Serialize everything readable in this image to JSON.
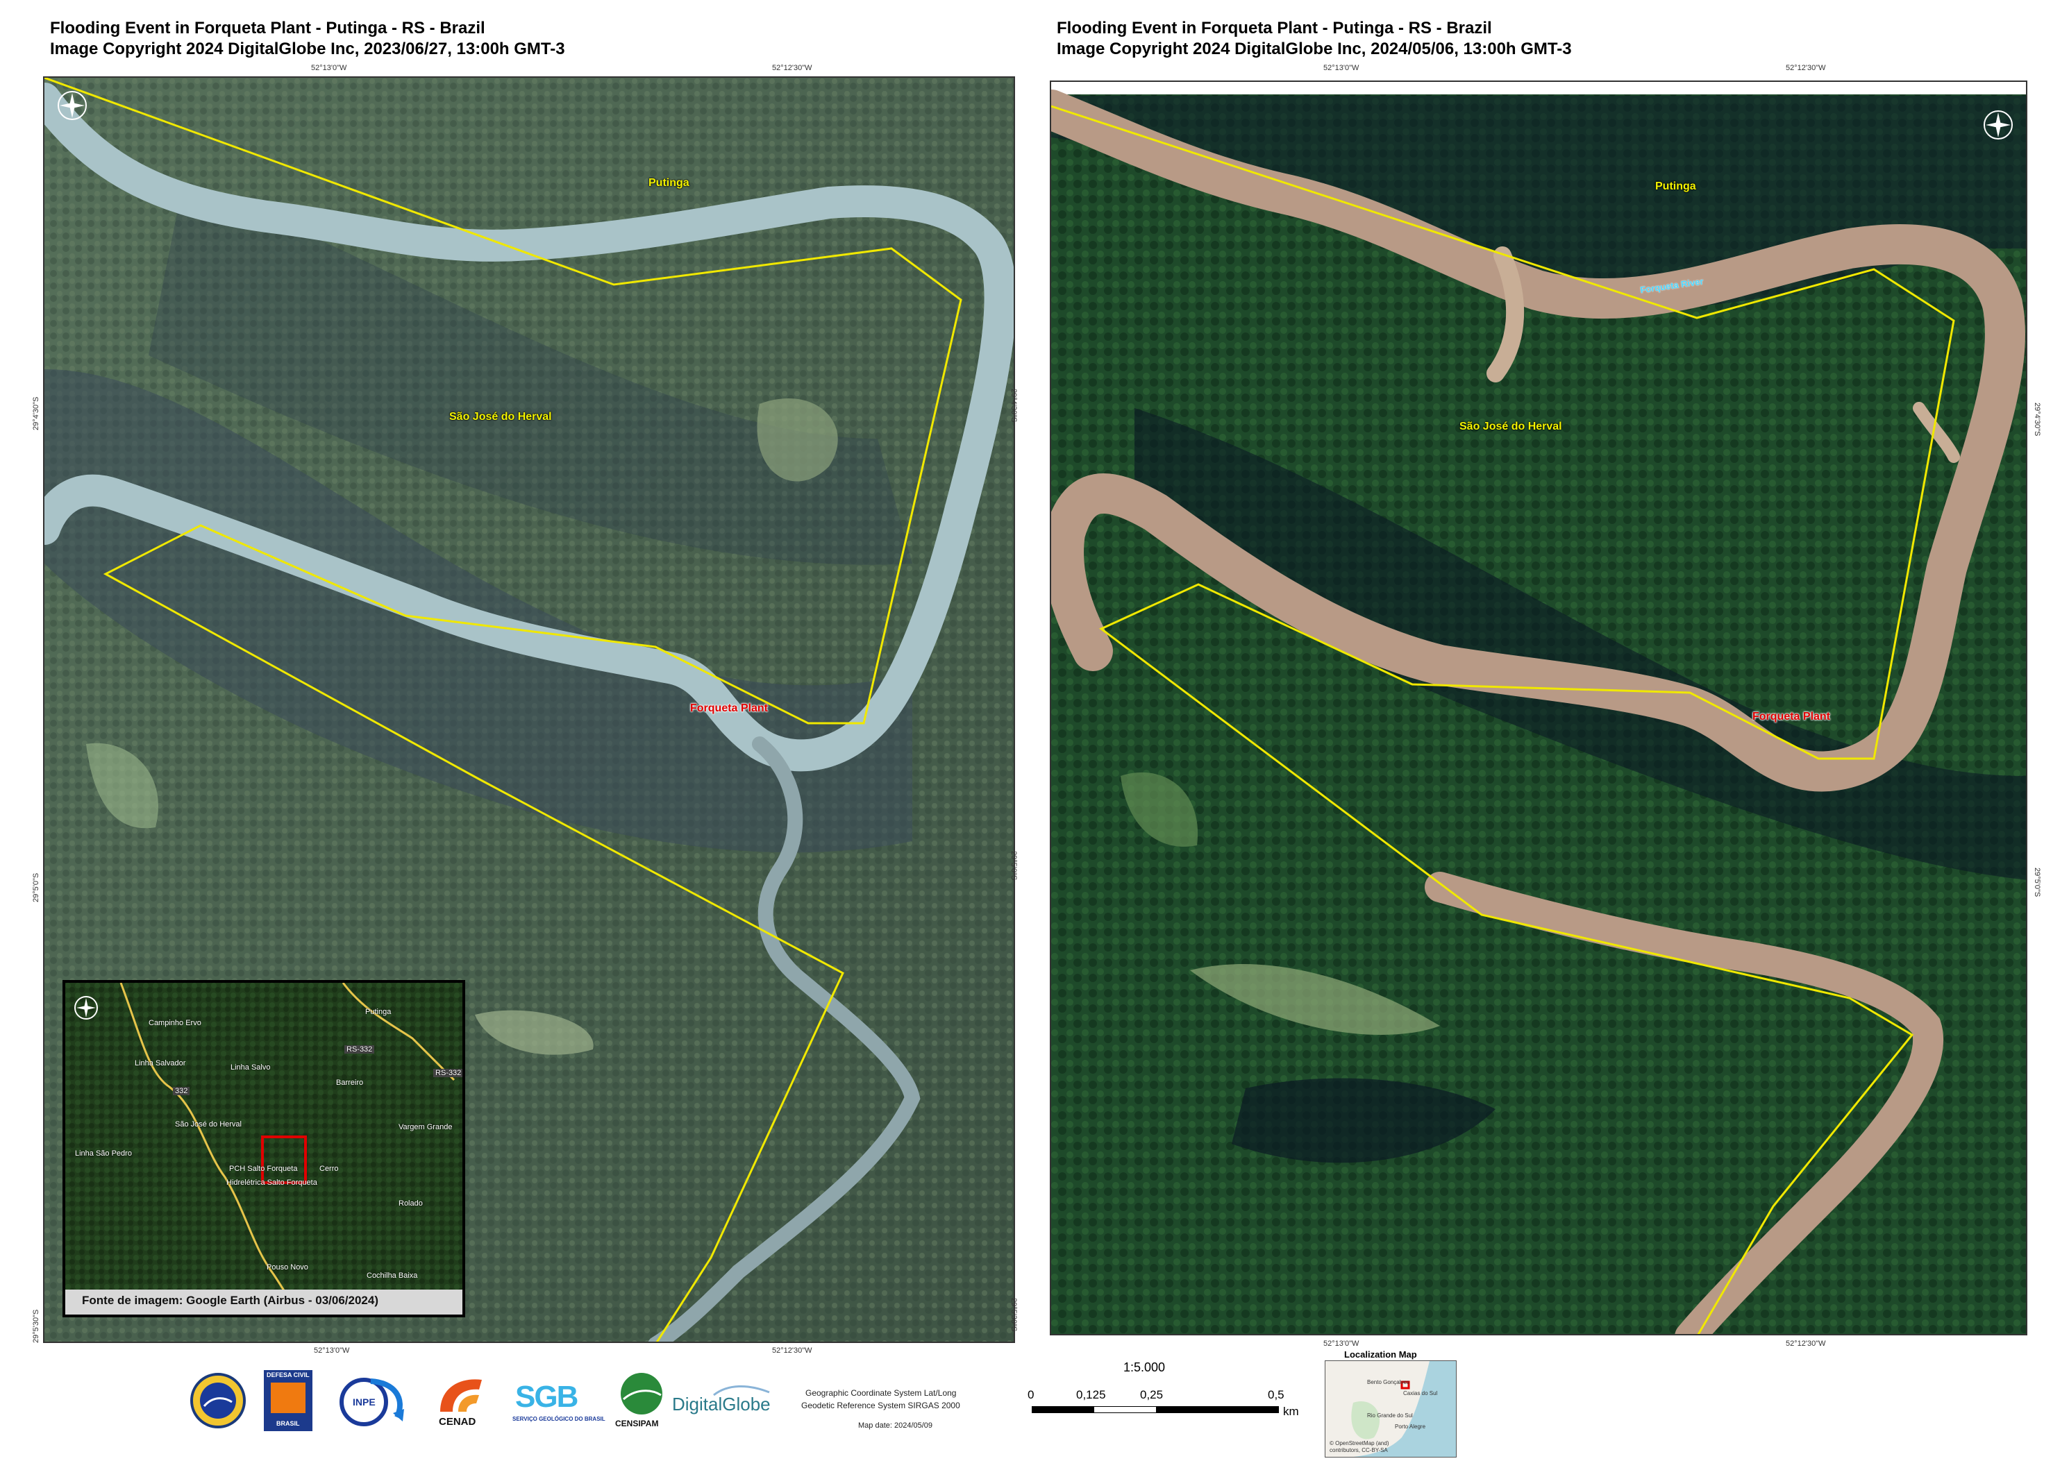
{
  "left_panel": {
    "title_line1": "Flooding Event in Forqueta Plant - Putinga - RS -  Brazil",
    "title_line2": "Image Copyright 2024 DigitalGlobe Inc, 2023/06/27, 13:00h GMT-3",
    "top_ticks": [
      "52°13'0\"W",
      "52°12'30\"W"
    ],
    "bottom_ticks": [
      "52°13'0\"W",
      "52°12'30\"W"
    ],
    "left_ticks": [
      "29°4'30\"S",
      "29°5'0\"S",
      "29°5'30\"S"
    ],
    "right_ticks": [
      "29°4'30\"S",
      "29°5'0\"S",
      "29°5'30\"S"
    ],
    "labels": {
      "putinga": "Putinga",
      "sao_jose": "São José do Herval",
      "forqueta_plant": "Forqueta Plant"
    },
    "inset": {
      "places": [
        "Campinho Ervo",
        "Linha Salvo",
        "Putinga",
        "Linha Salvador",
        "Barreiro",
        "São José do Herval",
        "Vargem Grande",
        "Linha São Pedro",
        "PCH Salto Forqueta",
        "Cerro",
        "Hidrelétrica Salto Forqueta",
        "Rolado",
        "Pouso Novo",
        "Cochilha Baixa"
      ],
      "roads": [
        "332",
        "RS-332",
        "RS-332"
      ],
      "caption": "Fonte de imagem: Google Earth (Airbus - 03/06/2024)"
    }
  },
  "right_panel": {
    "title_line1": "Flooding Event in Forqueta Plant - Putinga - RS -  Brazil",
    "title_line2": "Image Copyright 2024 DigitalGlobe Inc, 2024/05/06, 13:00h GMT-3",
    "top_ticks": [
      "52°13'0\"W",
      "52°12'30\"W"
    ],
    "bottom_ticks": [
      "52°13'0\"W",
      "52°12'30\"W"
    ],
    "right_ticks": [
      "29°4'30\"S",
      "29°5'0\"S"
    ],
    "labels": {
      "putinga": "Putinga",
      "forqueta_river": "Forqueta River",
      "sao_jose": "São José do Herval",
      "forqueta_plant": "Forqueta Plant"
    }
  },
  "footer": {
    "logos": {
      "defesa_civil_top": "DEFESA CIVIL",
      "defesa_civil_bottom": "BRASIL",
      "inpe": "INPE",
      "cenad": "CENAD",
      "sgb": "SGB",
      "sgb_sub": "SERVIÇO GEOLÓGICO DO BRASIL",
      "censipam": "CENSIPAM",
      "digitalglobe": "DigitalGlobe"
    },
    "info_line1": "Geographic Coordinate System Lat/Long",
    "info_line2": "Geodetic Reference System SIRGAS 2000",
    "map_date": "Map date: 2024/05/09",
    "scale_ratio": "1:5.000",
    "scale_ticks": [
      "0",
      "0,125",
      "0,25",
      "0,5"
    ],
    "scale_unit": "km",
    "loc_map_title": "Localization Map",
    "loc_map_places": [
      "Caxias do Sul",
      "Bento Gonçalves",
      "Rio Grande do Sul",
      "Porto Alegre"
    ],
    "loc_map_credit": "© OpenStreetMap (and) contributors, CC-BY-SA"
  },
  "colors": {
    "aoi_line": "#f0e800",
    "river_2023": "#a9c3c8",
    "river_2024": "#b89a86",
    "forest_2023": "#3f5a45",
    "forest_2024": "#1f4a2a"
  }
}
